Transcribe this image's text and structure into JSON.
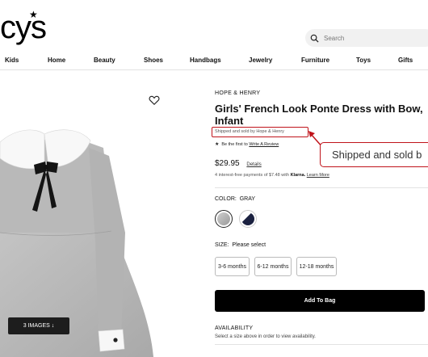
{
  "logo": {
    "text": "cys"
  },
  "search": {
    "placeholder": "Search"
  },
  "nav": {
    "items": [
      "Kids",
      "Home",
      "Beauty",
      "Shoes",
      "Handbags",
      "Jewelry",
      "Furniture",
      "Toys",
      "Gifts"
    ]
  },
  "product": {
    "brand": "HOPE & HENRY",
    "title": "Girls' French Look Ponte Dress with Bow, Infant",
    "shipped": "Shipped and sold by Hope & Henry",
    "review_prefix": "Be the first to",
    "review_link": "Write A Review",
    "price": "$29.95",
    "details_link": "Details",
    "klarna_text": "4 interest-free payments of $7.48 with",
    "klarna_brand": "Klarna.",
    "learn_more": "Learn More",
    "color_label": "COLOR:",
    "color_value": "GRAY",
    "size_label": "SIZE:",
    "size_value": "Please select",
    "sizes": [
      "3-6 months",
      "6-12 months",
      "12-18 months"
    ],
    "add_to_bag": "Add To Bag",
    "availability_title": "AVAILABILITY",
    "availability_text": "Select a size above in order to view availability.",
    "images_button": "3 IMAGES ↓"
  },
  "callout": {
    "text": "Shipped and sold b"
  },
  "colors": {
    "highlight": "#c0141b",
    "button": "#000000",
    "dress": "#b5b5b5"
  },
  "icons": [
    "star-icon",
    "search-icon",
    "heart-icon",
    "arrow-icon"
  ]
}
